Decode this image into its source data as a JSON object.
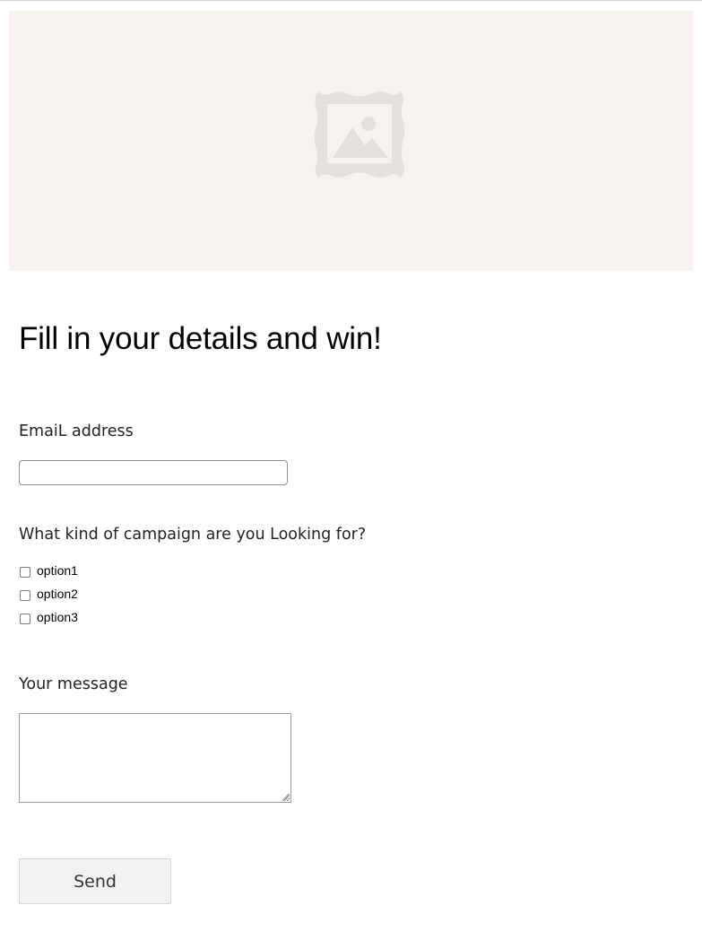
{
  "hero": {
    "icon": "image-placeholder-icon",
    "background_color": "#f6f2ed",
    "icon_color": "#e4e0db"
  },
  "form": {
    "title": "Fill in your details and win!",
    "email": {
      "label": "EmaiL address",
      "value": "",
      "placeholder": ""
    },
    "campaign": {
      "label": "What kind of campaign are you Looking for?",
      "options": [
        {
          "label": "option1",
          "checked": false
        },
        {
          "label": "option2",
          "checked": false
        },
        {
          "label": "option3",
          "checked": false
        }
      ]
    },
    "message": {
      "label": "Your message",
      "value": ""
    },
    "submit_label": "Send"
  }
}
